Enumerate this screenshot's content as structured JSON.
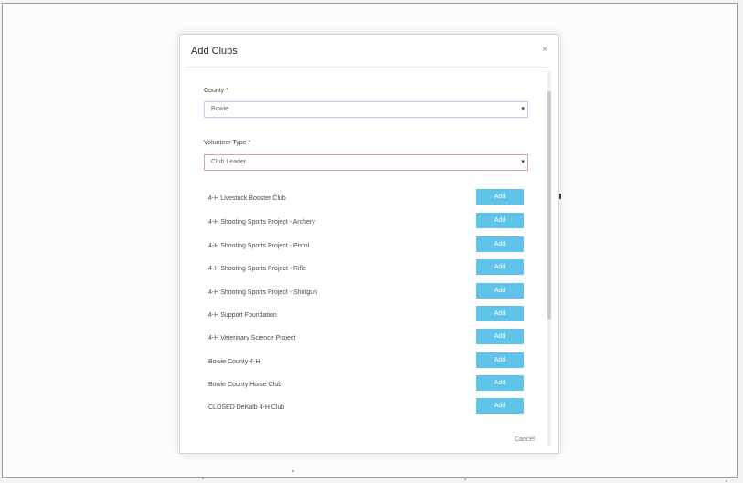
{
  "modal": {
    "title": "Add Clubs",
    "close_glyph": "×",
    "county": {
      "label": "County *",
      "value": "Bowie"
    },
    "volunteer_type": {
      "label": "Volunteer Type *",
      "value": "Club Leader"
    },
    "add_label": "Add",
    "clubs": [
      "4-H Livestock Booster Club",
      "4-H Shooting Sports Project - Archery",
      "4-H Shooting Sports Project - Pistol",
      "4-H Shooting Sports Project - Rifle",
      "4-H Shooting Sports Project - Shotgun",
      "4-H Support Foundation",
      "4-H Veterinary Science Project",
      "Bowie County 4-H",
      "Bowie County Horse Club",
      "CLOSED DeKalb 4-H Club"
    ],
    "cancel_label": "Cancel"
  },
  "colors": {
    "add_button": "#5fc3ea",
    "background_accent": "#1f66a8"
  },
  "icons": {
    "close": "close-icon",
    "dropdown": "chevron-down-icon"
  }
}
